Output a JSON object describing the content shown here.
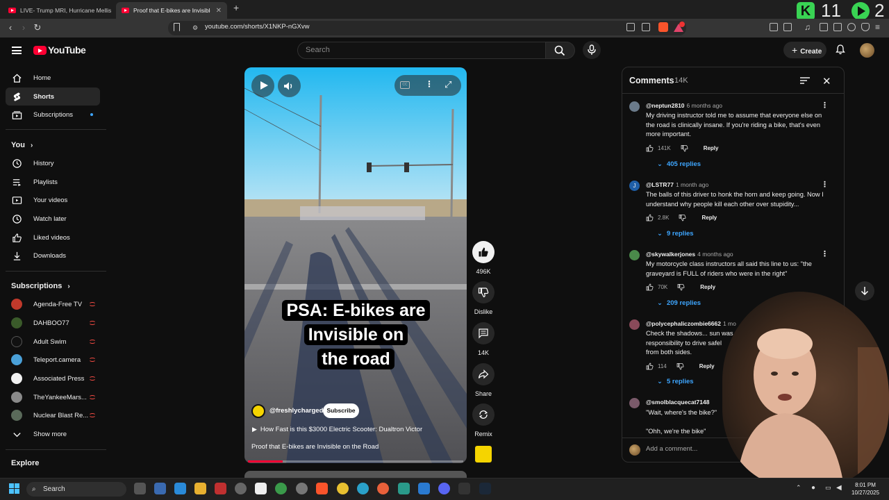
{
  "browser": {
    "tabs": [
      {
        "title": "LIVE- Trump MRI, Hurricane Mellis",
        "active": false
      },
      {
        "title": "Proof that E-bikes are Invisible o",
        "active": true
      }
    ],
    "new_tab": "+",
    "url": "youtube.com/shorts/X1NKP-nGXvw"
  },
  "overlay": {
    "counter1": "11",
    "counter2": "2"
  },
  "header": {
    "logo_text": "YouTube",
    "search_placeholder": "Search",
    "create_label": "Create"
  },
  "sidebar": {
    "main": [
      {
        "label": "Home",
        "icon": "home-icon"
      },
      {
        "label": "Shorts",
        "icon": "shorts-icon",
        "selected": true
      },
      {
        "label": "Subscriptions",
        "icon": "subscriptions-icon"
      }
    ],
    "you_header": "You",
    "you": [
      {
        "label": "History",
        "icon": "history-icon"
      },
      {
        "label": "Playlists",
        "icon": "playlists-icon"
      },
      {
        "label": "Your videos",
        "icon": "your-videos-icon"
      },
      {
        "label": "Watch later",
        "icon": "watch-later-icon"
      },
      {
        "label": "Liked videos",
        "icon": "liked-videos-icon"
      },
      {
        "label": "Downloads",
        "icon": "downloads-icon"
      }
    ],
    "subs_header": "Subscriptions",
    "subscriptions": [
      {
        "label": "Agenda-Free TV",
        "color": "#c0392b"
      },
      {
        "label": "DAHBOO77",
        "color": "#3a5a2a"
      },
      {
        "label": "Adult Swim",
        "color": "#111111"
      },
      {
        "label": "Teleport.camera",
        "color": "#4aa0d8"
      },
      {
        "label": "Associated Press",
        "color": "#f1f1f1"
      },
      {
        "label": "TheYankeeMars...",
        "color": "#8a8a8a"
      },
      {
        "label": "Nuclear Blast Re...",
        "color": "#5a6a5a"
      }
    ],
    "show_more": "Show more",
    "explore_header": "Explore"
  },
  "video": {
    "caption_lines": [
      "PSA: E-bikes are",
      "Invisible on",
      "the road"
    ],
    "channel": "@freshlycharged",
    "subscribe_label": "Subscribe",
    "related": "How Fast is this $3000 Electric Scooter: Dualtron Victor",
    "title": "Proof that E-bikes are Invisible on the Road",
    "progress": 0.16
  },
  "actions": {
    "likes": "496K",
    "dislike": "Dislike",
    "comments": "14K",
    "share": "Share",
    "remix": "Remix"
  },
  "comments": {
    "title": "Comments",
    "count": "14K",
    "add_placeholder": "Add a comment...",
    "items": [
      {
        "user": "@neptun2810",
        "time": "6 months ago",
        "text": "My driving instructor told me to assume that everyone else on the road is clinically insane. If you're riding a bike, that's even more important.",
        "likes": "141K",
        "reply": "Reply",
        "replies": "405 replies",
        "avatar": "#6a7a8a"
      },
      {
        "user": "@LSTR77",
        "time": "1 month ago",
        "text": "The balls of this driver to honk the horn and keep going. Now I understand why people kill each other over stupidity...",
        "likes": "2.8K",
        "reply": "Reply",
        "replies": "9 replies",
        "avatar": "#1f5fa8",
        "initial": "J"
      },
      {
        "user": "@skywalkerjones",
        "time": "4 months ago",
        "text": "My motorcycle class instructors all said this line to us: \"the graveyard is FULL of riders who were in the right\"",
        "likes": "70K",
        "reply": "Reply",
        "replies": "209 replies",
        "avatar": "#4a8a4a"
      },
      {
        "user": "@polycephaliczombie6662",
        "time": "1 mo",
        "text": "Check the shadows... sun was responsibility to drive safel from both sides.",
        "likes": "114",
        "reply": "Reply",
        "replies": "5 replies",
        "avatar": "#8a4a5a"
      },
      {
        "user": "@smolblacquecat7148",
        "time": "",
        "text": "\"Wait, where's the bike?\"",
        "text2": "\"Ohh, we're the bike\"",
        "avatar": "#7a5a6a"
      }
    ]
  },
  "taskbar": {
    "search_label": "Search",
    "time": "8:01 PM",
    "date": "10/27/2025"
  }
}
